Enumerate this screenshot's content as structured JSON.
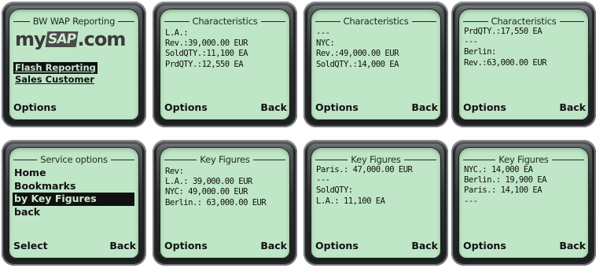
{
  "phones": [
    {
      "title": "BW WAP Reporting",
      "logo_left": "my",
      "logo_mid": "SAP",
      "logo_right": ".com",
      "menu": [
        "Flash Reporting",
        "Sales Customer"
      ],
      "soft_left": "Options",
      "soft_right": ""
    },
    {
      "title": "Characteristics",
      "lines": [
        "L.A.:",
        "Rev.:39,000.00 EUR",
        "SoldQTY.:11,100 EA",
        "PrdQTY.:12,550 EA"
      ],
      "soft_left": "Options",
      "soft_right": "Back"
    },
    {
      "title": "Characteristics",
      "lines": [
        "---",
        "NYC:",
        "Rev.:49,000.00 EUR",
        "SoldQTY.:14,000 EA"
      ],
      "soft_left": "Options",
      "soft_right": "Back"
    },
    {
      "title": "Characteristics",
      "lines": [
        "PrdQTY.:17,550 EA",
        "---",
        "Berlin:",
        "Rev.:63,000.00 EUR"
      ],
      "soft_left": "Options",
      "soft_right": "Back"
    },
    {
      "title": "Service options",
      "items": [
        "Home",
        "Bookmarks",
        "by Key Figures",
        "back"
      ],
      "selected_index": 2,
      "soft_left": "Select",
      "soft_right": "Back"
    },
    {
      "title": "Key Figures",
      "lines": [
        "Rev:",
        "L.A.: 39,000.00 EUR",
        "NYC: 49,000.00 EUR",
        "Berlin.: 63,000.00 EUR"
      ],
      "soft_left": "Options",
      "soft_right": "Back"
    },
    {
      "title": "Key Figures",
      "lines": [
        "Paris.: 47,000.00 EUR",
        "---",
        "SoldQTY:",
        "L.A.: 11,100 EA"
      ],
      "soft_left": "Options",
      "soft_right": "Back"
    },
    {
      "title": "Key Figures",
      "lines": [
        "NYC.: 14,000 EA",
        "Berlin.: 19,900 EA",
        "Paris.: 14,100 EA",
        "---"
      ],
      "soft_left": "Options",
      "soft_right": "Back"
    }
  ]
}
